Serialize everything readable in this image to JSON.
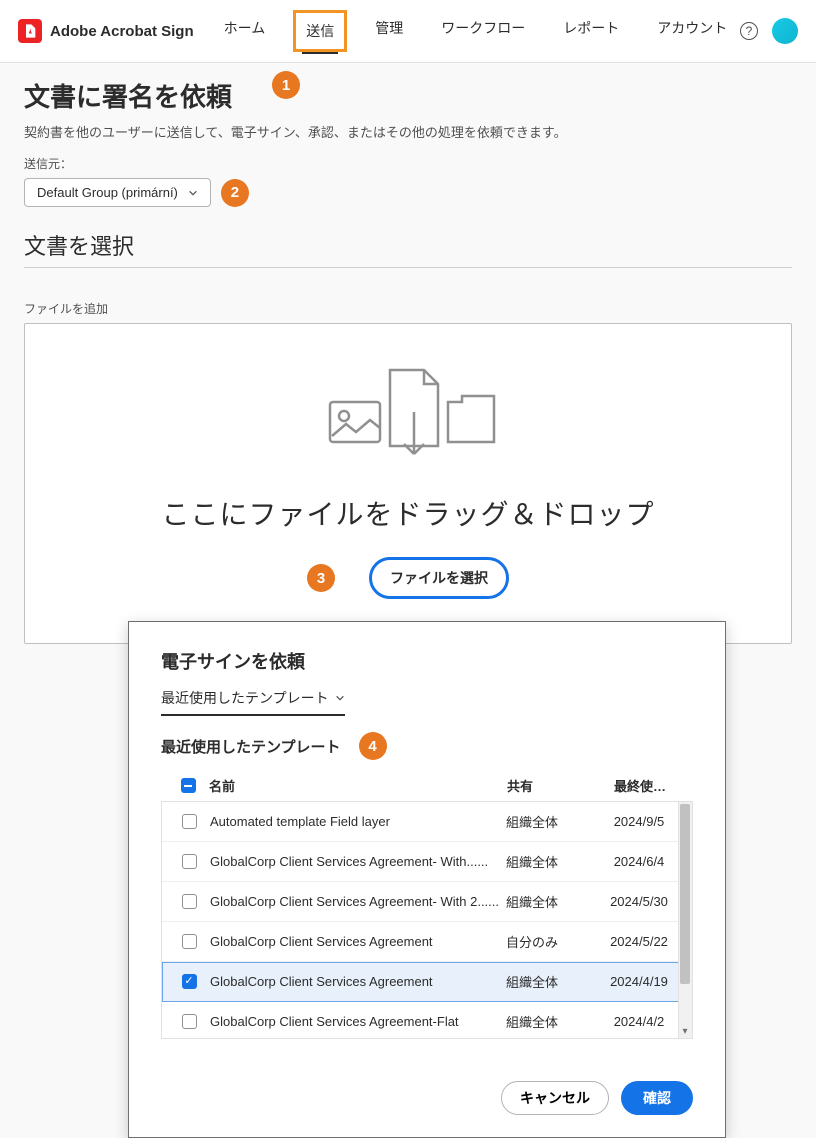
{
  "brand": "Adobe Acrobat Sign",
  "nav": [
    "ホーム",
    "送信",
    "管理",
    "ワークフロー",
    "レポート",
    "アカウント"
  ],
  "help": "?",
  "page": {
    "title": "文書に署名を依頼",
    "subtitle": "契約書を他のユーザーに送信して、電子サイン、承認、またはその他の処理を依頼できます。",
    "sendFromLabel": "送信元：",
    "sendFromValue": "Default Group (primární)",
    "selectDocTitle": "文書を選択",
    "addFilesLabel": "ファイルを追加",
    "dropText": "ここにファイルをドラッグ＆ドロップ",
    "selectFilesBtn": "ファイルを選択"
  },
  "modal": {
    "title": "電子サインを依頼",
    "tab": "最近使用したテンプレート",
    "sectionTitle": "最近使用したテンプレート",
    "cols": {
      "name": "名前",
      "share": "共有",
      "last": "最終使…"
    },
    "rows": [
      {
        "name": "Automated template Field layer",
        "share": "組織全体",
        "date": "2024/9/5",
        "checked": false
      },
      {
        "name": "GlobalCorp Client Services Agreement- With......",
        "share": "組織全体",
        "date": "2024/6/4",
        "checked": false
      },
      {
        "name": "GlobalCorp Client Services Agreement- With 2......",
        "share": "組織全体",
        "date": "2024/5/30",
        "checked": false
      },
      {
        "name": "GlobalCorp Client Services Agreement",
        "share": "自分のみ",
        "date": "2024/5/22",
        "checked": false
      },
      {
        "name": "GlobalCorp Client Services Agreement",
        "share": "組織全体",
        "date": "2024/4/19",
        "checked": true
      },
      {
        "name": "GlobalCorp Client Services Agreement-Flat",
        "share": "組織全体",
        "date": "2024/4/2",
        "checked": false
      }
    ],
    "cancel": "キャンセル",
    "confirm": "確認"
  },
  "callouts": {
    "c1": "1",
    "c2": "2",
    "c3": "3",
    "c4": "4"
  }
}
